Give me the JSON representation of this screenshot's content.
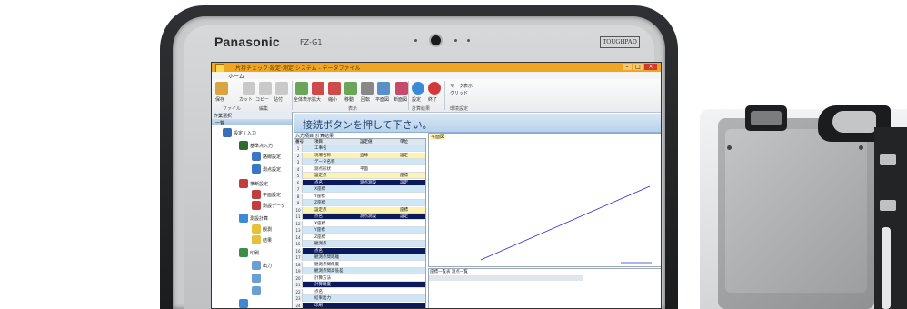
{
  "tablet": {
    "brand": "Panasonic",
    "model": "FZ-G1",
    "series_logo": "TOUGHPAD"
  },
  "app": {
    "titlebar_text": "片持チェック·設定·測定·システム - データファイル",
    "menu_home": "ホーム",
    "ribbon": {
      "buttons": [
        "保存",
        "カット",
        "コピー",
        "貼付",
        "全体表示",
        "拡大",
        "縮小",
        "移動",
        "回転",
        "平面図",
        "断面図",
        "設定",
        "終了"
      ],
      "groups": [
        "ファイル",
        "編集",
        "表示",
        "計算結果",
        "環境設定"
      ],
      "options": [
        "マーク表示",
        "グリッド"
      ]
    },
    "banner": "接続ボタンを押して下さい。",
    "left_panel": {
      "header": "作業選択",
      "tab": "一覧",
      "items": [
        "設定 / 入力",
        "基準点入力",
        "路線設定",
        "測点設定",
        "横断設定",
        "平面設定",
        "測設データ",
        "測設計算",
        "観測",
        "結果",
        "印刷",
        "出力"
      ]
    },
    "grid": {
      "tabs": [
        "入力項目",
        "計算結果"
      ],
      "headers": [
        "番号",
        "項目",
        "設定値",
        "単位"
      ],
      "rows": [
        [
          "1",
          "工事名",
          "",
          ""
        ],
        [
          "2",
          "現場名称",
          "直線",
          "設定"
        ],
        [
          "3",
          "データ名称",
          "",
          ""
        ],
        [
          "4",
          "測点形状",
          "平面",
          ""
        ],
        [
          "5",
          "設定点",
          "",
          "座標"
        ],
        [
          "6",
          "点名",
          "測点測設",
          "設定"
        ],
        [
          "7",
          "X座標",
          "",
          ""
        ],
        [
          "8",
          "Y座標",
          "",
          ""
        ],
        [
          "9",
          "Z座標",
          "",
          ""
        ],
        [
          "10",
          "設定点",
          "",
          "座標"
        ],
        [
          "11",
          "点名",
          "測点測設",
          "設定"
        ],
        [
          "12",
          "X座標",
          "",
          ""
        ],
        [
          "13",
          "Y座標",
          "",
          ""
        ],
        [
          "14",
          "Z座標",
          "",
          ""
        ],
        [
          "15",
          "観測点",
          "",
          ""
        ],
        [
          "16",
          "点名",
          "",
          ""
        ],
        [
          "17",
          "観測点間距離",
          "",
          ""
        ],
        [
          "18",
          "観測点間角度",
          "",
          ""
        ],
        [
          "19",
          "観測点間高低差",
          "",
          ""
        ],
        [
          "20",
          "計算方法",
          "",
          ""
        ],
        [
          "21",
          "計算精度",
          "",
          ""
        ],
        [
          "22",
          "点名",
          "",
          ""
        ],
        [
          "23",
          "結果出力",
          "",
          ""
        ],
        [
          "24",
          "印刷",
          "",
          ""
        ]
      ]
    },
    "drawing": {
      "label": "平面図"
    },
    "lower": {
      "tabs": "座標一覧表  測点一覧"
    }
  },
  "colors": {
    "titlebar": "#f0a623",
    "banner": "#b8d2ec",
    "grid_dark_row": "#0c1a5c",
    "grid_light_row": "#cfe6f7",
    "grid_yellow_row": "#fff3b0",
    "drawing_line": "#2b2bd8"
  }
}
